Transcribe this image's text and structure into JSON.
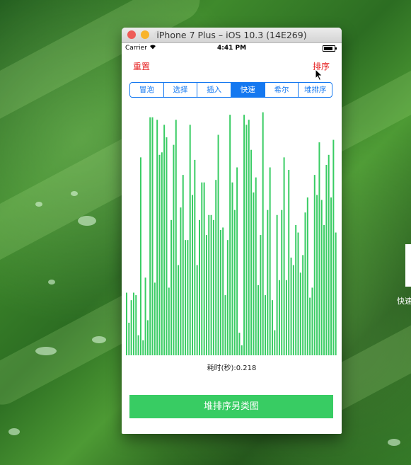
{
  "window": {
    "title": "iPhone 7 Plus – iOS 10.3 (14E269)",
    "colors": {
      "close": "#ee5c57",
      "minimize": "#f8b42c",
      "zoom": "#dcdcdc"
    }
  },
  "status_bar": {
    "carrier": "Carrier",
    "wifi_icon": "wifi-icon",
    "time": "4:41 PM",
    "battery_icon": "battery-icon"
  },
  "nav": {
    "reset_label": "重置",
    "sort_label": "排序",
    "accent_color": "#e62020"
  },
  "segments": {
    "items": [
      "冒泡",
      "选择",
      "插入",
      "快速",
      "希尔",
      "堆排序"
    ],
    "selected": "快速",
    "color": "#1478f0"
  },
  "chart_data": {
    "type": "bar",
    "color": "#38cc63",
    "ylim": [
      0,
      100
    ],
    "values": [
      25,
      13,
      22,
      25,
      24,
      8,
      79,
      6,
      31,
      14,
      95,
      95,
      29,
      94,
      80,
      81,
      92,
      87,
      27,
      54,
      84,
      94,
      36,
      59,
      72,
      46,
      46,
      92,
      64,
      78,
      36,
      54,
      69,
      69,
      48,
      56,
      56,
      54,
      70,
      88,
      50,
      51,
      24,
      46,
      96,
      69,
      58,
      75,
      9,
      4,
      96,
      92,
      94,
      82,
      65,
      71,
      28,
      48,
      97,
      24,
      58,
      75,
      22,
      10,
      56,
      30,
      58,
      79,
      30,
      74,
      39,
      36,
      52,
      49,
      33,
      40,
      57,
      63,
      23,
      27,
      72,
      64,
      85,
      62,
      52,
      76,
      80,
      63,
      86,
      49
    ],
    "xlabel": "",
    "ylabel": ""
  },
  "result": {
    "time_text": "耗时(秒):0.218"
  },
  "heap_button": {
    "label": "堆排序另类图",
    "color": "#38cc63"
  },
  "side": {
    "label": "快速"
  }
}
